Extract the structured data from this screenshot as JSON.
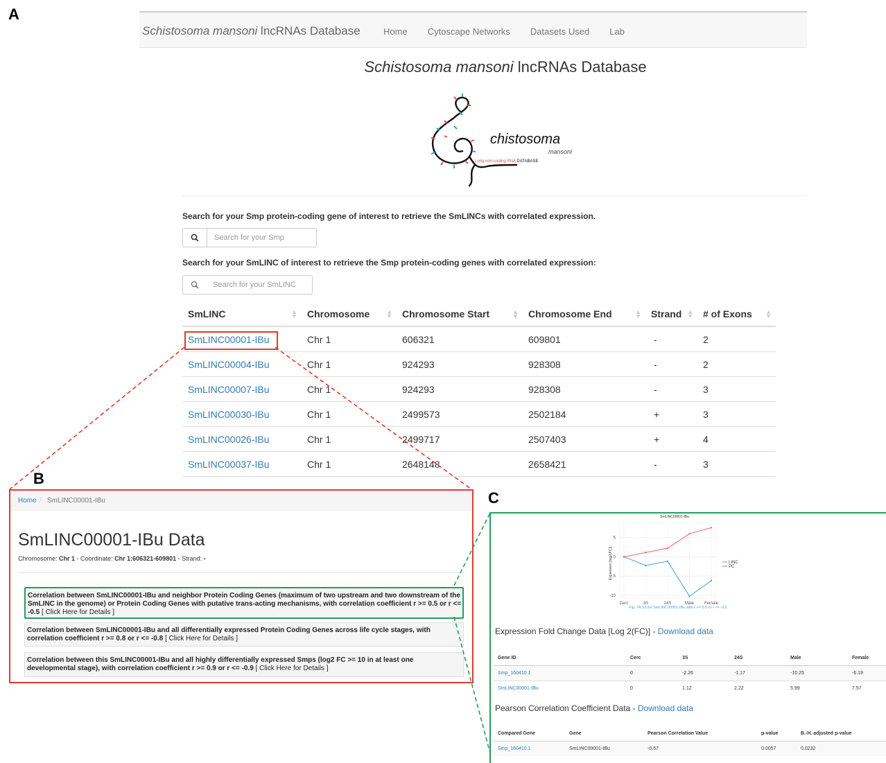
{
  "panel_letters": {
    "a": "A",
    "b": "B",
    "c": "C"
  },
  "navbar": {
    "brand_italic": "Schistosoma mansoni",
    "brand_rest": " lncRNAs Database",
    "links": [
      "Home",
      "Cytoscape Networks",
      "Datasets Used",
      "Lab"
    ]
  },
  "page_title": {
    "italic": "Schistosoma mansoni",
    "rest": " lncRNAs Database"
  },
  "logo": {
    "word": "chistosoma",
    "sub": "mansoni",
    "tag_red": "Long non-coding RNA",
    "tag_black": " DATABASE"
  },
  "search1": {
    "label": "Search for your Smp protein-coding gene of interest to retrieve the SmLINCs with correlated expression.",
    "placeholder": "Search for your Smp"
  },
  "search2": {
    "label": "Search for your SmLINC of interest to retrieve the Smp protein-coding genes with correlated expression:",
    "placeholder": "Search for your SmLINC"
  },
  "table": {
    "headers": [
      "SmLINC",
      "Chromosome",
      "Chromosome Start",
      "Chromosome End",
      "Strand",
      "# of Exons"
    ],
    "rows": [
      [
        "SmLINC00001-IBu",
        "Chr 1",
        "606321",
        "609801",
        "-",
        "2"
      ],
      [
        "SmLINC00004-IBu",
        "Chr 1",
        "924293",
        "928308",
        "-",
        "2"
      ],
      [
        "SmLINC00007-IBu",
        "Chr 1",
        "924293",
        "928308",
        "-",
        "3"
      ],
      [
        "SmLINC00030-IBu",
        "Chr 1",
        "2499573",
        "2502184",
        "+",
        "3"
      ],
      [
        "SmLINC00026-IBu",
        "Chr 1",
        "2499717",
        "2507403",
        "+",
        "4"
      ],
      [
        "SmLINC00037-IBu",
        "Chr 1",
        "2648148",
        "2658421",
        "-",
        "3"
      ]
    ]
  },
  "panelB": {
    "breadcrumb_home": "Home",
    "breadcrumb_sep": "/",
    "breadcrumb_current": "SmLINC00001-IBu",
    "title": "SmLINC00001-IBu Data",
    "sub_l1": "Chromosome: ",
    "sub_v1": "Chr 1",
    "sub_l2": " - Coordinate: ",
    "sub_v2": "Chr 1:606321-609801",
    "sub_l3": " - Strand: ",
    "sub_v3": "-",
    "corr": [
      {
        "text": "Correlation between SmLINC00001-IBu and neighbor Protein Coding Genes (maximum of two upstream and two downstream of the SmLINC in the genome) or Protein Coding Genes with putative trans-acting mechanisms, with correlation coefficient r >= 0.5 or r <= -0.5",
        "link": " [ Click Here for Details ]"
      },
      {
        "text": "Correlation between SmLINC00001-IBu and all differentially expressed Protein Coding Genes across life cycle stages, with correlation coefficient r >= 0.8 or r <= -0.8",
        "link": " [ Click Here for Details ]"
      },
      {
        "text": "Correlation between this SmLINC00001-IBu and all highly differentially expressed Smps (log2 FC >= 10 in at least one developmental stage), with correlation coefficient r >= 0.9 or r <= -0.9",
        "link": " [ Click Here for Details ]"
      }
    ]
  },
  "chart_data": {
    "type": "line",
    "title": "SmLINC00001-IBu",
    "ylabel": "Expression [log2(FC)]",
    "categories": [
      "Cerc",
      "3S",
      "24S",
      "Male",
      "Female"
    ],
    "ylim": [
      -10,
      8
    ],
    "yticks": [
      5,
      0,
      -5,
      -10
    ],
    "series": [
      {
        "name": "LINC",
        "color": "#f0606a",
        "values": [
          0,
          1.12,
          2.22,
          5.99,
          7.57
        ]
      },
      {
        "name": "PC",
        "color": "#4a9be0",
        "values": [
          0,
          -2.26,
          -1.17,
          -10.25,
          -6.19
        ]
      }
    ],
    "caption": "Fig. 7A S3 for SmLINC00001-IBu with r >= 0.5 or r <= -0.5",
    "legend": "right"
  },
  "panelC": {
    "fc_heading": "Expression Fold Change Data [Log 2(FC)] - ",
    "fc_download": "Download data",
    "fc_headers": [
      "Gene ID",
      "Cerc",
      "3S",
      "24S",
      "Male",
      "Female"
    ],
    "fc_rows": [
      [
        "Smp_160410.1",
        "0",
        "-2.26",
        "-1.17",
        "-10.25",
        "-6.19"
      ],
      [
        "SmLINC00001-IBu",
        "0",
        "1.12",
        "2.22",
        "5.99",
        "7.57"
      ]
    ],
    "pc_heading": "Pearson Correlation Coefficient Data - ",
    "pc_download": "Download data",
    "pc_headers": [
      "Compared Gene",
      "Gene",
      "Pearson Correlation Value",
      "p-value",
      "B.-H. adjusted p-value"
    ],
    "pc_rows": [
      [
        "Smp_160410.1",
        "SmLINC00001-IBu",
        "-0.67",
        "0.0057",
        "0.0232"
      ]
    ]
  },
  "colors": {
    "link": "#337ab7",
    "red_box": "#e2392c",
    "green_box": "#1fa05a"
  }
}
